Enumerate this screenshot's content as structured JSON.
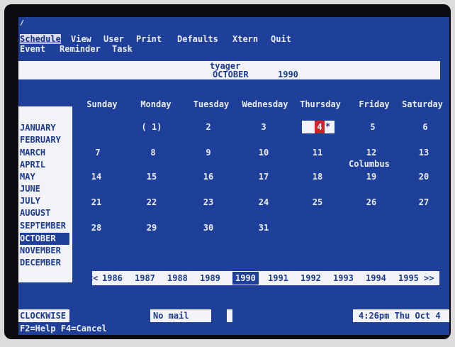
{
  "menu": {
    "row1": [
      "Schedule",
      "View",
      "User",
      "Print",
      "Defaults",
      "Xtern",
      "Quit"
    ],
    "row2": [
      "Event",
      "Reminder",
      "Task"
    ]
  },
  "header": {
    "user": "tyager",
    "month": "OCTOBER",
    "year": "1990"
  },
  "weekdays": [
    "Sunday",
    "Monday",
    "Tuesday",
    "Wednesday",
    "Thursday",
    "Friday",
    "Saturday"
  ],
  "weeks": [
    [
      "",
      "( 1)",
      "2",
      "3",
      "4",
      "5",
      "6"
    ],
    [
      "7",
      "8",
      "9",
      "10",
      "11",
      "12",
      "13"
    ],
    [
      "14",
      "15",
      "16",
      "17",
      "18",
      "19",
      "20"
    ],
    [
      "21",
      "22",
      "23",
      "24",
      "25",
      "26",
      "27"
    ],
    [
      "28",
      "29",
      "30",
      "31",
      "",
      "",
      ""
    ]
  ],
  "today": {
    "day": "4",
    "marker": "*"
  },
  "holiday": {
    "label": "Columbus"
  },
  "months": [
    "JANUARY",
    "FEBRUARY",
    "MARCH",
    "APRIL",
    "MAY",
    "JUNE",
    "JULY",
    "AUGUST",
    "SEPTEMBER",
    "OCTOBER",
    "NOVEMBER",
    "DECEMBER"
  ],
  "selected_month": "OCTOBER",
  "years": {
    "prev": "<<",
    "list": [
      "1986",
      "1987",
      "1988",
      "1989",
      "1990",
      "1991",
      "1992",
      "1993",
      "1994",
      "1995"
    ],
    "next": ">>"
  },
  "status": {
    "clock_label": "CLOCKWISE",
    "mail": "No mail",
    "time": "4:26pm Thu Oct  4",
    "help": "F2=Help F4=Cancel"
  },
  "colors": {
    "screen": "#1e3f9a",
    "panel": "#f2f3f6",
    "today": "#d1242a"
  }
}
